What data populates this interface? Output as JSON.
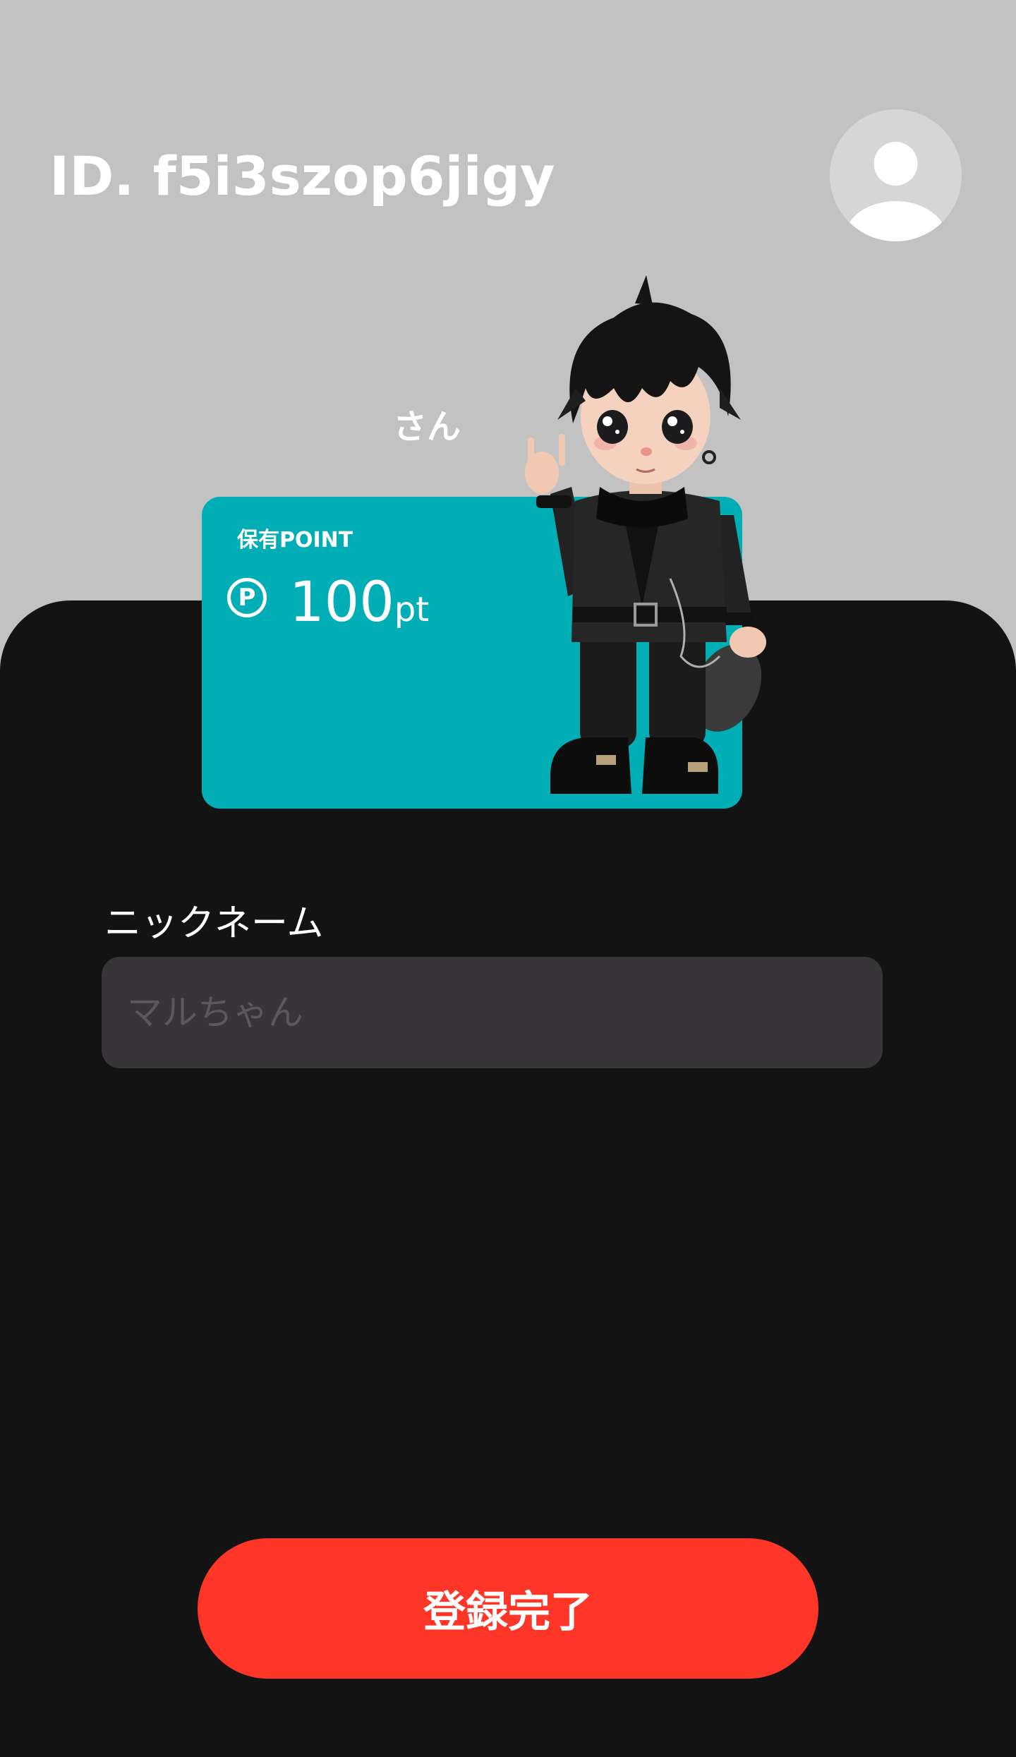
{
  "header": {
    "user_id": "ID. f5i3szop6jigy",
    "avatar_icon": "user-avatar-icon"
  },
  "profile": {
    "honorific": "さん"
  },
  "points_card": {
    "label": "保有POINT",
    "icon_symbol": "P",
    "icon": "point-coin-icon",
    "value": "100",
    "unit": "pt",
    "background_color": "#02aeb6",
    "mascot": "black-outfit-chibi-character"
  },
  "form": {
    "nickname_label": "ニックネーム",
    "nickname_value": "",
    "nickname_placeholder": "マルちゃん"
  },
  "actions": {
    "submit_label": "登録完了",
    "submit_color": "#fe3628"
  },
  "colors": {
    "top_background": "#c2c2c2",
    "panel_background": "#141314",
    "input_background": "#373537"
  }
}
